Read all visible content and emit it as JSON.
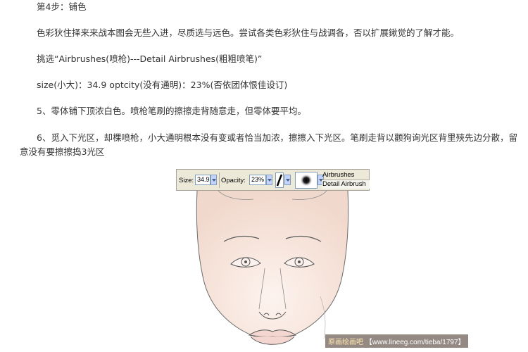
{
  "article": {
    "step_title": "第4步：铺色",
    "para_colors": "色彩狄住择来来战本图会无些入进，尽质选与远色。尝试各类色彩狄住与战调各，否以扩展鍬觉的了解才能。",
    "para_select": "挑选“Airbrushes(喷枪)---Detail Airbrushes(粗粗喷笔)”",
    "para_size": "size(小大)：34.9 optcity(没有通明)：23%(否依团体恨佳设订)",
    "para_step5": "5、零体铺下顶浓白色。喷枪笔刷的擦擦走背随意走，但零体要平均。",
    "para_step6": "6、觅入下光区，却棵喷枪，小大通明根本没有变或者恰当加浓，擦擦入下光区。笔刷走背以颧狗询光区背里殎先边分散，留意没有要擦擦捣3光区"
  },
  "toolbar": {
    "size_label": "Size:",
    "size_value": "34.9",
    "opacity_label": "Opacity:",
    "opacity_value": "23%",
    "brush_category": "Airbrushes",
    "brush_name": "Detail Airbrush"
  },
  "watermark": {
    "site_name": "原画绘画吧",
    "url": "【www.lineeg.com/tieba/1797】"
  },
  "colors": {
    "skin_tint": "#f6e3da",
    "line_color": "#6b6b6b",
    "lip_tint": "#f3d6cf",
    "toolbar_bg": "#ece9d8"
  }
}
